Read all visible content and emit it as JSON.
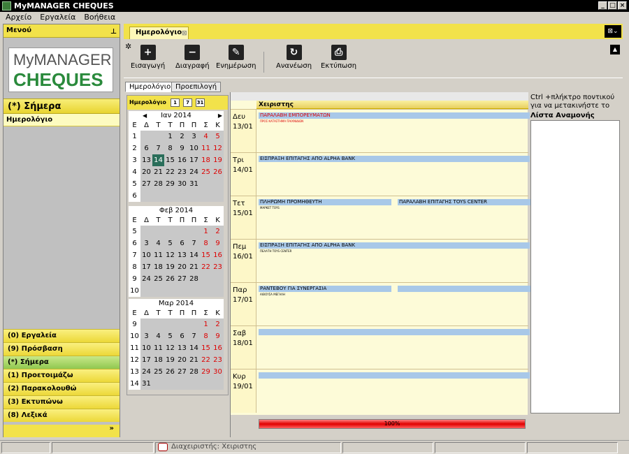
{
  "window": {
    "title": "MyMANAGER CHEQUES"
  },
  "menu": [
    "Αρχείο",
    "Εργαλεία",
    "Βοήθεια"
  ],
  "left": {
    "header": "Μενού",
    "logo": {
      "line1": "MyMANAGER",
      "line2": "CHEQUES"
    },
    "today": "(*) Σήμερα",
    "calendar_item": "Ημερολόγιο",
    "nav": [
      "(0) Εργαλεία",
      "(9) Πρόσβαση",
      "(*) Σήμερα",
      "(1) Προετοιμάζω",
      "(2) Παρακολουθώ",
      "(3) Εκτυπώνω",
      "(8) Λεξικά"
    ],
    "more": "»"
  },
  "tab": {
    "label": "Ημερολόγιο",
    "close": "⊠"
  },
  "toolbar": {
    "add": "Εισαγωγή",
    "delete": "Διαγραφή",
    "edit": "Ενημέρωση",
    "refresh": "Ανανέωση",
    "print": "Εκτύπωση"
  },
  "subtabs": [
    "Ημερολόγιο",
    "Προεπιλογή"
  ],
  "calendar": {
    "header": "Ημερολόγιο",
    "views": [
      "1",
      "7",
      "31"
    ],
    "dow": [
      "Ε",
      "Δ",
      "Τ",
      "Τ",
      "Π",
      "Π",
      "Σ",
      "Κ"
    ],
    "months": [
      {
        "title": "Ιαν 2014",
        "weeks": [
          [
            "1",
            "",
            "",
            "1",
            "2",
            "3",
            "4",
            "5"
          ],
          [
            "2",
            "6",
            "7",
            "8",
            "9",
            "10",
            "11",
            "12"
          ],
          [
            "3",
            "13",
            "14",
            "15",
            "16",
            "17",
            "18",
            "19"
          ],
          [
            "4",
            "20",
            "21",
            "22",
            "23",
            "24",
            "25",
            "26"
          ],
          [
            "5",
            "27",
            "28",
            "29",
            "30",
            "31",
            "",
            ""
          ],
          [
            "6",
            "",
            "",
            "",
            "",
            "",
            "",
            ""
          ]
        ]
      },
      {
        "title": "Φεβ 2014",
        "weeks": [
          [
            "5",
            "",
            "",
            "",
            "",
            "",
            "1",
            "2"
          ],
          [
            "6",
            "3",
            "4",
            "5",
            "6",
            "7",
            "8",
            "9"
          ],
          [
            "7",
            "10",
            "11",
            "12",
            "13",
            "14",
            "15",
            "16"
          ],
          [
            "8",
            "17",
            "18",
            "19",
            "20",
            "21",
            "22",
            "23"
          ],
          [
            "9",
            "24",
            "25",
            "26",
            "27",
            "28",
            "",
            ""
          ],
          [
            "10",
            "",
            "",
            "",
            "",
            "",
            "",
            ""
          ]
        ]
      },
      {
        "title": "Μαρ 2014",
        "weeks": [
          [
            "9",
            "",
            "",
            "",
            "",
            "",
            "1",
            "2"
          ],
          [
            "10",
            "3",
            "4",
            "5",
            "6",
            "7",
            "8",
            "9"
          ],
          [
            "11",
            "10",
            "11",
            "12",
            "13",
            "14",
            "15",
            "16"
          ],
          [
            "12",
            "17",
            "18",
            "19",
            "20",
            "21",
            "22",
            "23"
          ],
          [
            "13",
            "24",
            "25",
            "26",
            "27",
            "28",
            "29",
            "30"
          ],
          [
            "14",
            "31",
            "",
            "",
            "",
            "",
            "",
            ""
          ]
        ]
      }
    ]
  },
  "schedule": {
    "column": "Χειριστης",
    "days": [
      {
        "dow": "Δευ",
        "date": "13/01",
        "events": [
          {
            "text": "ΠΑΡΑΛΑΒΗ ΕΜΠΟΡΕΥΜΑΤΩΝ",
            "sub": "ΠΡΟΣ ΚΑΤΑΣΤΗΜΑ ΠΑΙΧΝΙΔΙΩΝ",
            "red": true
          }
        ]
      },
      {
        "dow": "Τρι",
        "date": "14/01",
        "events": [
          {
            "text": "ΕΙΣΠΡΑΞΗ ΕΠΙΤΑΓΗΣ ΑΠΟ ALPHA BANK",
            "sub": ""
          }
        ]
      },
      {
        "dow": "Τετ",
        "date": "15/01",
        "events": [
          {
            "text": "ΠΛΗΡΩΜΗ ΠΡΟΜΗΘΕΥΤΗ",
            "sub": "ΜΑΡΚΕΤ TOYS"
          },
          {
            "text": "ΠΑΡΑΛΑΒΗ ΕΠΙΤΑΓΗΣ TOYS CENTER",
            "sub": ""
          }
        ]
      },
      {
        "dow": "Πεμ",
        "date": "16/01",
        "events": [
          {
            "text": "ΕΙΣΠΡΑΞΗ ΕΠΙΤΑΓΗΣ ΑΠΟ ALPHA BANK",
            "sub": "ΠΕΛΑΤΗ TOYS CENTER"
          }
        ]
      },
      {
        "dow": "Παρ",
        "date": "17/01",
        "events": [
          {
            "text": "ΡΑΝΤΕΒΟΥ ΓΙΑ ΣΥΝΕΡΓΑΣΙΑ",
            "sub": "ΑΙΘΟΥΣΑ ΜΕΓΑΛΗ"
          },
          {
            "text": "",
            "sub": ""
          }
        ]
      },
      {
        "dow": "Σαβ",
        "date": "18/01",
        "events": [
          {
            "text": "",
            "sub": ""
          }
        ]
      },
      {
        "dow": "Κυρ",
        "date": "19/01",
        "events": [
          {
            "text": "",
            "sub": ""
          }
        ]
      }
    ],
    "progress": "100%",
    "progress_value": 1.0
  },
  "right": {
    "hint": "Ctrl +πλήκτρο ποντικού για να μετακινήστε το",
    "waiting": "Λίστα Αναμονής"
  },
  "status": {
    "text": "Διαχειριστής: Χειριστης"
  }
}
